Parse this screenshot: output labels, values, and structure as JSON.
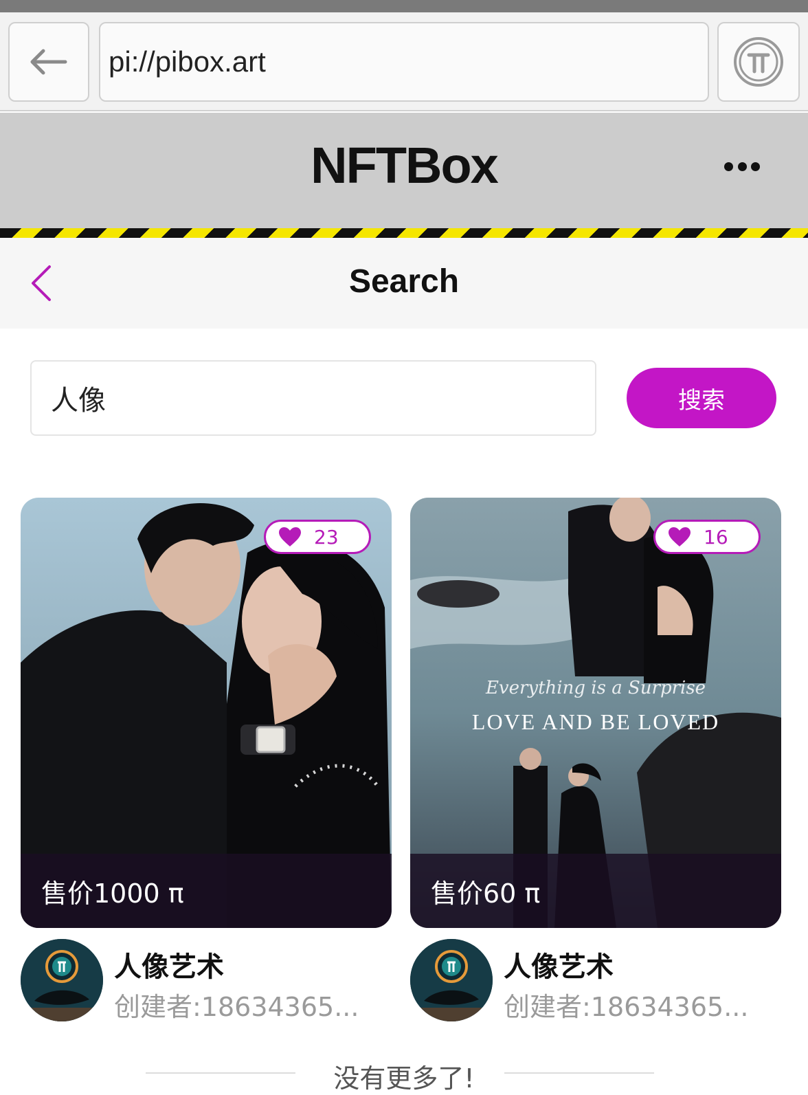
{
  "browser": {
    "url": "pi://pibox.art",
    "back_icon": "arrow-left-icon",
    "pi_icon": "pi-logo-icon"
  },
  "app": {
    "title": "NFTBox",
    "menu_icon": "more-horizontal-icon"
  },
  "subnav": {
    "title": "Search",
    "back_icon": "chevron-left-icon"
  },
  "search": {
    "value": "人像",
    "button_label": "搜索"
  },
  "colors": {
    "accent": "#c316c6",
    "header_bg": "#cccccc",
    "hazard_yellow": "#f5e600"
  },
  "results": [
    {
      "likes": "23",
      "price": "售价1000 π",
      "name": "人像艺术",
      "creator": "创建者:18634365..."
    },
    {
      "likes": "16",
      "price": "售价60 π",
      "name": "人像艺术",
      "creator": "创建者:18634365...",
      "overlay_script": "Everything is a Surprise",
      "overlay_title": "LOVE AND BE LOVED"
    }
  ],
  "footer": {
    "end_text": "没有更多了!"
  }
}
